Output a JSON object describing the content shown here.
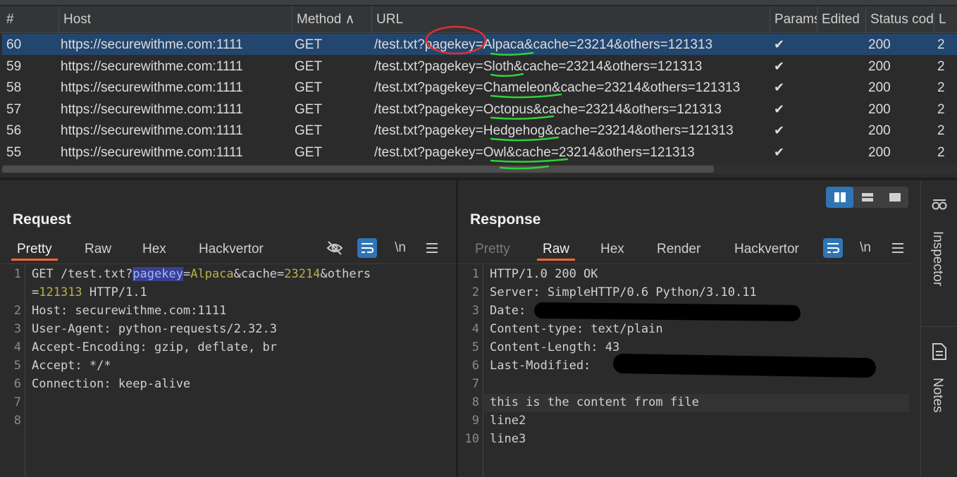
{
  "history": {
    "columns": [
      "#",
      "Host",
      "Method ∧",
      "URL",
      "Params",
      "Edited",
      "Status cod",
      "L"
    ],
    "rows": [
      {
        "num": "60",
        "host": "https://securewithme.com:1111",
        "method": "GET",
        "url": "/test.txt?pagekey=Alpaca&cache=23214&others=121313",
        "params": "✔",
        "edited": "",
        "status": "200",
        "len": "2"
      },
      {
        "num": "59",
        "host": "https://securewithme.com:1111",
        "method": "GET",
        "url": "/test.txt?pagekey=Sloth&cache=23214&others=121313",
        "params": "✔",
        "edited": "",
        "status": "200",
        "len": "2"
      },
      {
        "num": "58",
        "host": "https://securewithme.com:1111",
        "method": "GET",
        "url": "/test.txt?pagekey=Chameleon&cache=23214&others=121313",
        "params": "✔",
        "edited": "",
        "status": "200",
        "len": "2"
      },
      {
        "num": "57",
        "host": "https://securewithme.com:1111",
        "method": "GET",
        "url": "/test.txt?pagekey=Octopus&cache=23214&others=121313",
        "params": "✔",
        "edited": "",
        "status": "200",
        "len": "2"
      },
      {
        "num": "56",
        "host": "https://securewithme.com:1111",
        "method": "GET",
        "url": "/test.txt?pagekey=Hedgehog&cache=23214&others=121313",
        "params": "✔",
        "edited": "",
        "status": "200",
        "len": "2"
      },
      {
        "num": "55",
        "host": "https://securewithme.com:1111",
        "method": "GET",
        "url": "/test.txt?pagekey=Owl&cache=23214&others=121313",
        "params": "✔",
        "edited": "",
        "status": "200",
        "len": "2"
      }
    ],
    "selected_index": 0
  },
  "request": {
    "title": "Request",
    "tabs": [
      "Pretty",
      "Raw",
      "Hex",
      "Hackvertor"
    ],
    "active_tab": "Pretty",
    "toolbar_icons": [
      "eye-off-icon",
      "wrap-icon",
      "newline-icon",
      "menu-icon"
    ],
    "newline_label": "\\n",
    "line_numbers": [
      "1",
      "",
      "2",
      "3",
      "4",
      "5",
      "6",
      "7",
      "8"
    ],
    "line1": {
      "method": "GET /test.txt?",
      "key": "pagekey",
      "eq": "=",
      "val": "Alpaca",
      "rest1": "&cache=",
      "num1": "23214",
      "rest2": "&others"
    },
    "line1b": {
      "eq": "=",
      "num": "121313",
      "proto": " HTTP/1.1"
    },
    "lines": [
      "Host: securewithme.com:1111",
      "User-Agent: python-requests/2.32.3",
      "Accept-Encoding: gzip, deflate, br",
      "Accept: */*",
      "Connection: keep-alive"
    ]
  },
  "response": {
    "title": "Response",
    "tabs": [
      "Pretty",
      "Raw",
      "Hex",
      "Render",
      "Hackvertor"
    ],
    "active_tab": "Raw",
    "toolbar_icons": [
      "wrap-icon",
      "newline-icon",
      "menu-icon"
    ],
    "newline_label": "\\n",
    "line_numbers": [
      "1",
      "2",
      "3",
      "4",
      "5",
      "6",
      "7",
      "8",
      "9",
      "10"
    ],
    "lines": [
      "HTTP/1.0 200 OK",
      "Server: SimpleHTTP/0.6 Python/3.10.11",
      "Date:",
      "Content-type: text/plain",
      "Content-Length: 43",
      "Last-Modified:",
      "",
      "this is the content from file",
      "line2",
      "line3"
    ]
  },
  "sidebar": {
    "inspector": "Inspector",
    "notes": "Notes"
  },
  "layout_modes": [
    "split-vertical-icon",
    "split-horizontal-icon",
    "single-pane-icon"
  ],
  "colors": {
    "selection": "#23466f",
    "accent_blue": "#2f75b5",
    "active_tab_underline": "#ff6633",
    "annotation_red": "#e03030",
    "annotation_green": "#2fd23a"
  }
}
